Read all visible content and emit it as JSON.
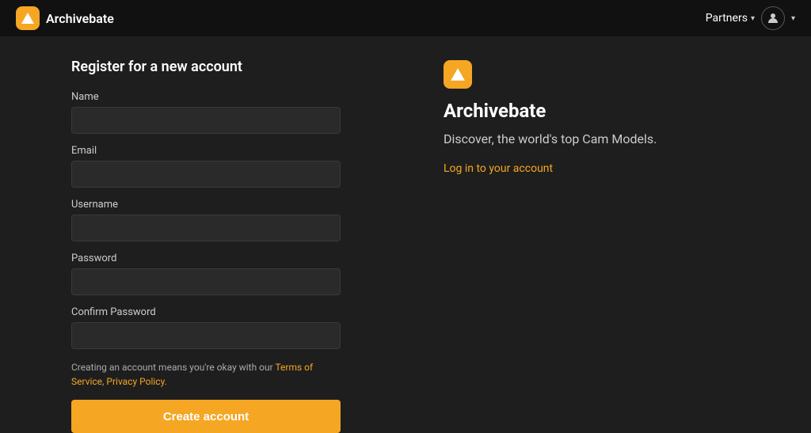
{
  "navbar": {
    "brand_name": "Archivebate",
    "partners_label": "Partners",
    "chevron": "▾"
  },
  "form": {
    "title": "Register for a new account",
    "name_label": "Name",
    "name_placeholder": "",
    "email_label": "Email",
    "email_placeholder": "",
    "username_label": "Username",
    "username_placeholder": "",
    "password_label": "Password",
    "password_placeholder": "",
    "confirm_password_label": "Confirm Password",
    "confirm_password_placeholder": "",
    "terms_prefix": "Creating an account means you're okay with our ",
    "terms_link": "Terms of Service",
    "terms_comma": ", ",
    "privacy_link": "Privacy Policy",
    "terms_suffix": ".",
    "create_account_label": "Create account"
  },
  "info": {
    "app_name": "Archivebate",
    "tagline": "Discover, the world's top Cam Models.",
    "login_link": "Log in to your account"
  }
}
